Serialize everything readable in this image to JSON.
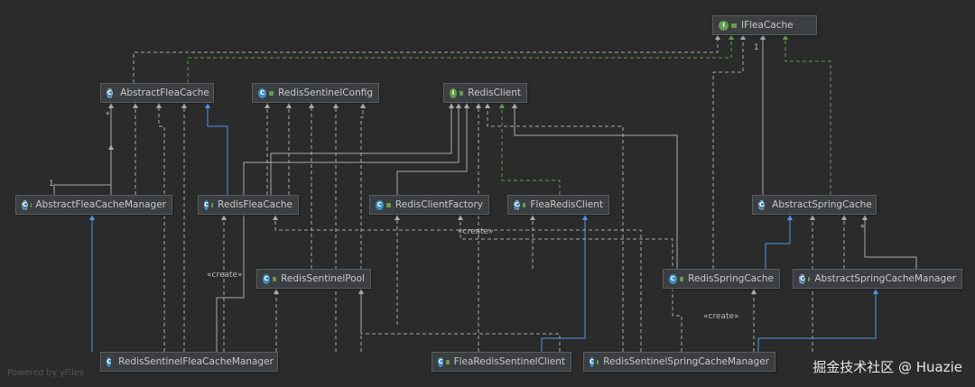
{
  "nodes": [
    {
      "id": "IFleaCache",
      "label": "IFleaCache",
      "kind": "interface",
      "icon": "interface-icon"
    },
    {
      "id": "AbstractFleaCache",
      "label": "AbstractFleaCache",
      "kind": "abstract",
      "icon": "abstract-class-icon"
    },
    {
      "id": "RedisSentinelConfig",
      "label": "RedisSentinelConfig",
      "kind": "class",
      "icon": "class-icon"
    },
    {
      "id": "RedisClient",
      "label": "RedisClient",
      "kind": "interface",
      "icon": "interface-icon"
    },
    {
      "id": "AbstractFleaCacheManager",
      "label": "AbstractFleaCacheManager",
      "kind": "abstract",
      "icon": "abstract-class-icon"
    },
    {
      "id": "RedisFleaCache",
      "label": "RedisFleaCache",
      "kind": "class",
      "icon": "class-icon"
    },
    {
      "id": "RedisClientFactory",
      "label": "RedisClientFactory",
      "kind": "class",
      "icon": "class-icon"
    },
    {
      "id": "FleaRedisClient",
      "label": "FleaRedisClient",
      "kind": "abstract",
      "icon": "abstract-class-icon"
    },
    {
      "id": "AbstractSpringCache",
      "label": "AbstractSpringCache",
      "kind": "abstract",
      "icon": "abstract-class-icon"
    },
    {
      "id": "RedisSentinelPool",
      "label": "RedisSentinelPool",
      "kind": "class",
      "icon": "class-icon"
    },
    {
      "id": "RedisSpringCache",
      "label": "RedisSpringCache",
      "kind": "class",
      "icon": "class-icon"
    },
    {
      "id": "AbstractSpringCacheManager",
      "label": "AbstractSpringCacheManager",
      "kind": "abstract",
      "icon": "abstract-class-icon"
    },
    {
      "id": "RedisSentinelFleaCacheManager",
      "label": "RedisSentinelFleaCacheManager",
      "kind": "class",
      "icon": "class-icon"
    },
    {
      "id": "FleaRedisSentinelClient",
      "label": "FleaRedisSentinelClient",
      "kind": "class",
      "icon": "class-icon"
    },
    {
      "id": "RedisSentinelSpringCacheManager",
      "label": "RedisSentinelSpringCacheManager",
      "kind": "class",
      "icon": "class-icon"
    }
  ],
  "labels": {
    "create1": "«create»",
    "create2": "«create»",
    "create3": "«create»",
    "one": "1",
    "star": "*"
  },
  "footer": {
    "powered": "Powered by yFiles",
    "watermark": "掘金技术社区 @ Huazie"
  },
  "colors": {
    "background": "#2b2b2b",
    "node": "#3c3f41",
    "edge": "#a9a9a9",
    "extends": "#5394ec",
    "implements": "#5f9e4a"
  }
}
